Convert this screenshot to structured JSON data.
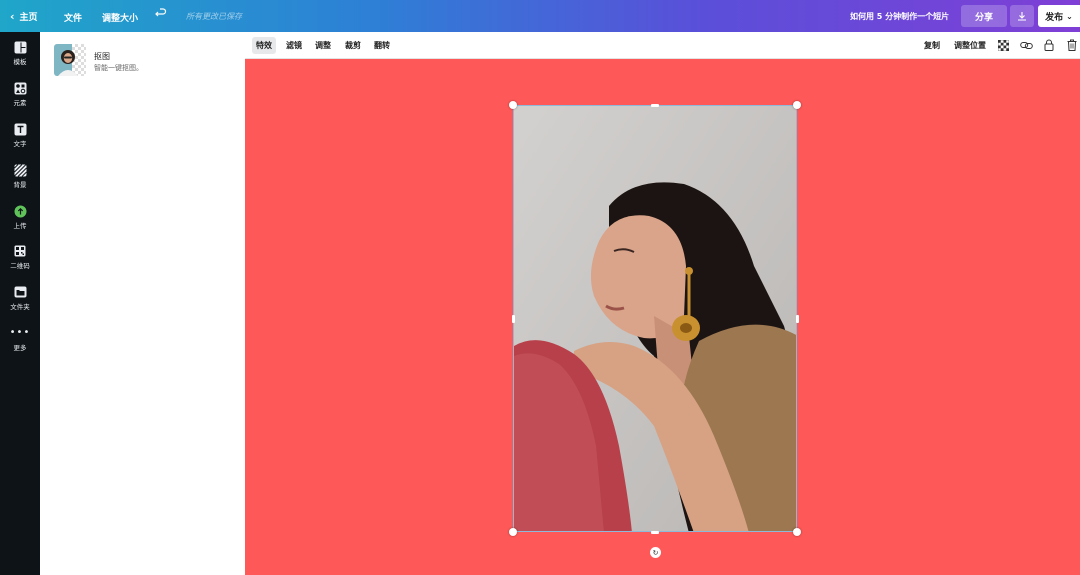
{
  "topbar": {
    "home_label": "主页",
    "file_label": "文件",
    "resize_label": "调整大小",
    "saved_text": "所有更改已保存",
    "howto_text": "如何用 5 分钟制作一个短片",
    "share_label": "分享",
    "publish_label": "发布"
  },
  "sidebar": {
    "items": [
      {
        "label": "模板",
        "icon": "template-icon"
      },
      {
        "label": "元素",
        "icon": "elements-icon"
      },
      {
        "label": "文字",
        "icon": "text-icon"
      },
      {
        "label": "背景",
        "icon": "background-icon"
      },
      {
        "label": "上传",
        "icon": "upload-icon"
      },
      {
        "label": "二维码",
        "icon": "qrcode-icon"
      },
      {
        "label": "文件夹",
        "icon": "folder-icon"
      },
      {
        "label": "更多",
        "icon": "more-icon"
      }
    ]
  },
  "panel": {
    "title": "抠图",
    "description": "智能一键抠图。"
  },
  "toolbar": {
    "effects_label": "特效",
    "filter_label": "滤镜",
    "adjust_label": "调整",
    "crop_label": "裁剪",
    "flip_label": "翻转",
    "copy_label": "复制",
    "position_label": "调整位置"
  },
  "colors": {
    "canvas_bg": "#fe5858",
    "sidebar_bg": "#0e1318",
    "selection": "#8fb9d9"
  }
}
